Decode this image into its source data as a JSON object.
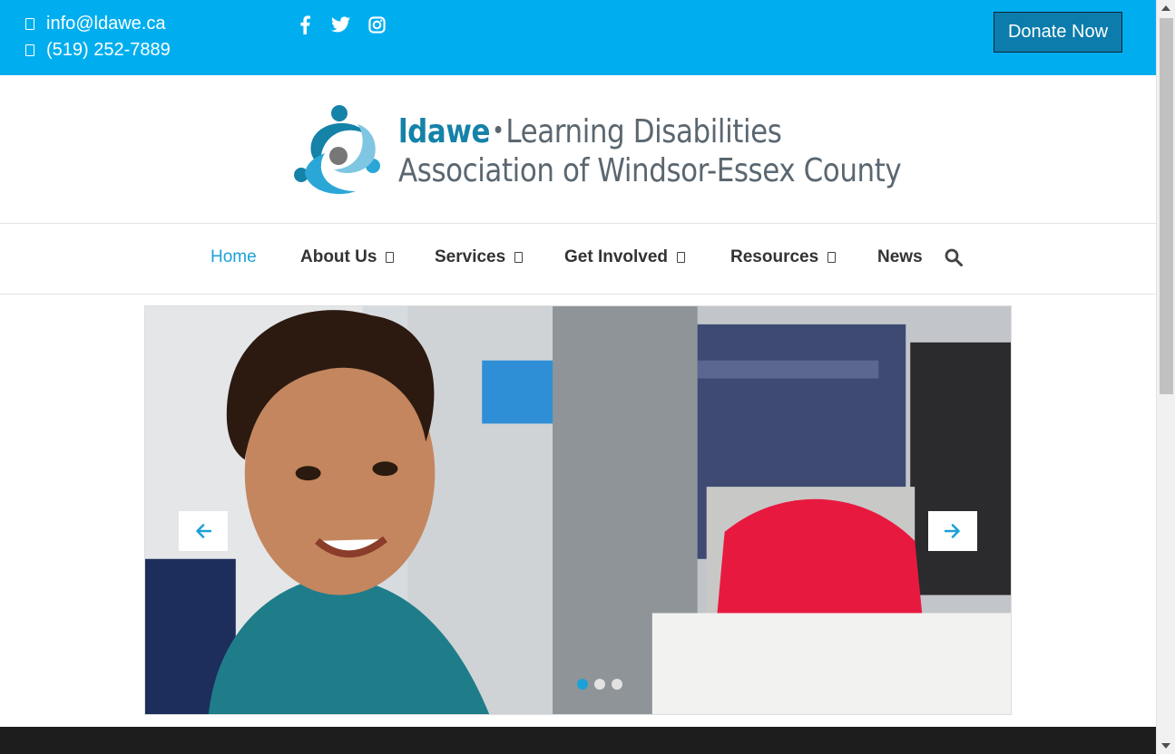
{
  "topbar": {
    "email": "info@ldawe.ca",
    "phone": "(519) 252-7889",
    "social": [
      {
        "icon": "facebook-icon"
      },
      {
        "icon": "twitter-icon"
      },
      {
        "icon": "instagram-icon"
      }
    ],
    "donate_label": "Donate Now",
    "background": "#00aeef"
  },
  "logo": {
    "brand": "ldawe",
    "line1": "Learning Disabilities",
    "line2": "Association of Windsor-Essex County"
  },
  "nav": {
    "items": [
      {
        "label": "Home",
        "active": true
      },
      {
        "label": "About Us",
        "dropdown": true
      },
      {
        "label": "Services",
        "dropdown": true
      },
      {
        "label": "Get Involved",
        "dropdown": true
      },
      {
        "label": "Resources",
        "dropdown": true
      },
      {
        "label": "News"
      }
    ],
    "accent": "#1ba1d8"
  },
  "slider": {
    "slide_count": 3,
    "active_slide": 1
  }
}
